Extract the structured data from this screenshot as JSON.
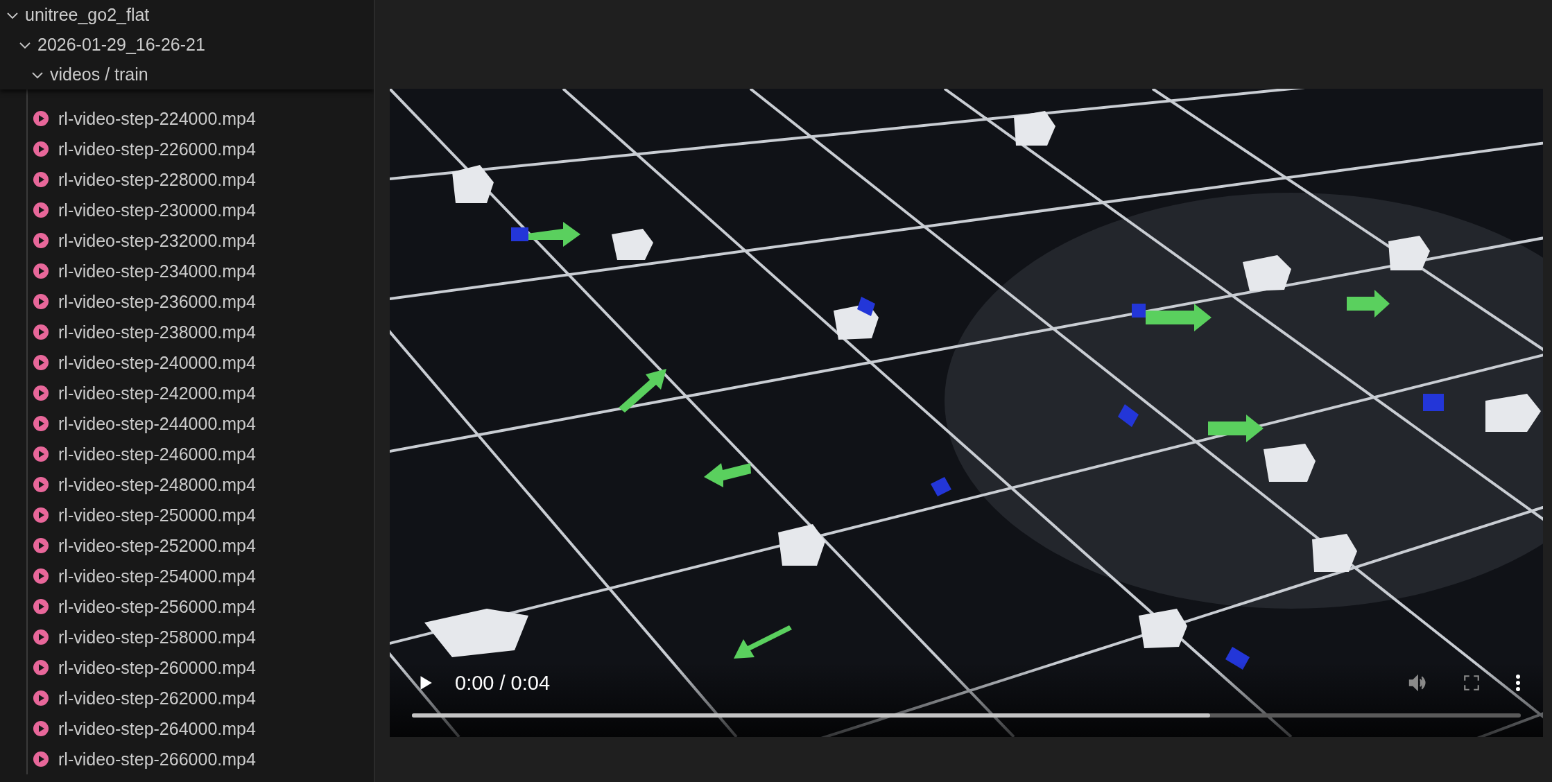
{
  "explorer": {
    "tree": [
      {
        "kind": "folder",
        "label": "unitree_go2_flat",
        "expanded": true,
        "children": [
          {
            "kind": "folder",
            "label": "2026-01-29_16-26-21",
            "expanded": true,
            "children": [
              {
                "kind": "folder",
                "label": "videos / train",
                "expanded": true,
                "children": [
                  {
                    "kind": "video",
                    "label": "rl-video-step-224000.mp4"
                  },
                  {
                    "kind": "video",
                    "label": "rl-video-step-226000.mp4"
                  },
                  {
                    "kind": "video",
                    "label": "rl-video-step-228000.mp4"
                  },
                  {
                    "kind": "video",
                    "label": "rl-video-step-230000.mp4"
                  },
                  {
                    "kind": "video",
                    "label": "rl-video-step-232000.mp4"
                  },
                  {
                    "kind": "video",
                    "label": "rl-video-step-234000.mp4"
                  },
                  {
                    "kind": "video",
                    "label": "rl-video-step-236000.mp4"
                  },
                  {
                    "kind": "video",
                    "label": "rl-video-step-238000.mp4"
                  },
                  {
                    "kind": "video",
                    "label": "rl-video-step-240000.mp4"
                  },
                  {
                    "kind": "video",
                    "label": "rl-video-step-242000.mp4"
                  },
                  {
                    "kind": "video",
                    "label": "rl-video-step-244000.mp4"
                  },
                  {
                    "kind": "video",
                    "label": "rl-video-step-246000.mp4"
                  },
                  {
                    "kind": "video",
                    "label": "rl-video-step-248000.mp4"
                  },
                  {
                    "kind": "video",
                    "label": "rl-video-step-250000.mp4"
                  },
                  {
                    "kind": "video",
                    "label": "rl-video-step-252000.mp4"
                  },
                  {
                    "kind": "video",
                    "label": "rl-video-step-254000.mp4"
                  },
                  {
                    "kind": "video",
                    "label": "rl-video-step-256000.mp4"
                  },
                  {
                    "kind": "video",
                    "label": "rl-video-step-258000.mp4"
                  },
                  {
                    "kind": "video",
                    "label": "rl-video-step-260000.mp4"
                  },
                  {
                    "kind": "video",
                    "label": "rl-video-step-262000.mp4"
                  },
                  {
                    "kind": "video",
                    "label": "rl-video-step-264000.mp4"
                  },
                  {
                    "kind": "video",
                    "label": "rl-video-step-266000.mp4"
                  }
                ]
              }
            ]
          }
        ]
      }
    ]
  },
  "video_player": {
    "time": "0:00 / 0:04",
    "progress": {
      "level": 0.72
    }
  }
}
